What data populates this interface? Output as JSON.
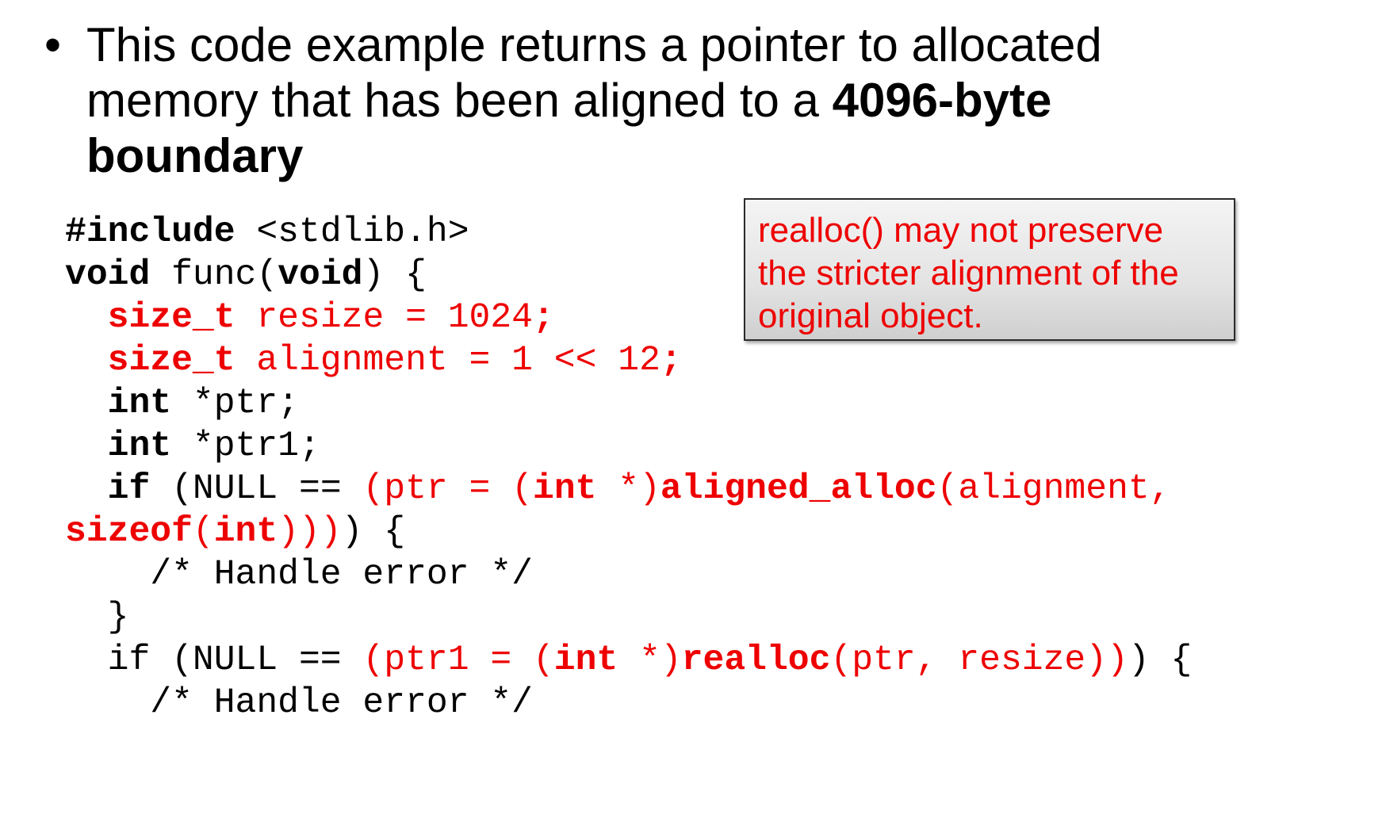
{
  "slide": {
    "bullet": {
      "symbol": "•",
      "text_line1": "This code example returns a pointer to allocated",
      "text_line2_pre": "memory that has been aligned to a ",
      "text_line2_bold": "4096-byte",
      "text_line3_bold": "boundary"
    },
    "callout": {
      "text": "realloc() may not preserve the stricter alignment of the original object."
    },
    "code": {
      "l1_kw": "#include",
      "l1_rest": " <stdlib.h>",
      "l2_kw": "void",
      "l2_a": " func(",
      "l2_kw2": "void",
      "l2_b": ") {",
      "l3_indent": "  ",
      "l3_kw": "size_t",
      "l3_rest": " resize = 1024",
      "l3_semi": ";",
      "l4_indent": "  ",
      "l4_kw": "size_t",
      "l4_rest": " alignment = 1 << 12",
      "l4_semi": ";",
      "l5_indent": "  ",
      "l5_kw": "int",
      "l5_rest": " *ptr;",
      "l6_indent": "  ",
      "l6_kw": "int",
      "l6_rest": " *ptr1;",
      "l7_indent": "  ",
      "l7_kw": "if",
      "l7_a": " (NULL == ",
      "l7_r1": "(ptr = (",
      "l7_rkw": "int",
      "l7_r2": " *)",
      "l7_rfn": "aligned_alloc",
      "l7_r3": "(alignment,",
      "l8_rkw": "sizeof",
      "l8_r1": "(",
      "l8_rkw2": "int",
      "l8_r2": ")))",
      "l8_b": ") {",
      "l9": "    /* Handle error */",
      "l10": "  }",
      "l11_a": "  if (NULL == ",
      "l11_r1": "(ptr1 = (",
      "l11_rkw": "int",
      "l11_r2": " *)",
      "l11_rfn": "realloc",
      "l11_r3": "(ptr, resize))",
      "l11_b": ") {",
      "l12": "    /* Handle error */"
    }
  }
}
